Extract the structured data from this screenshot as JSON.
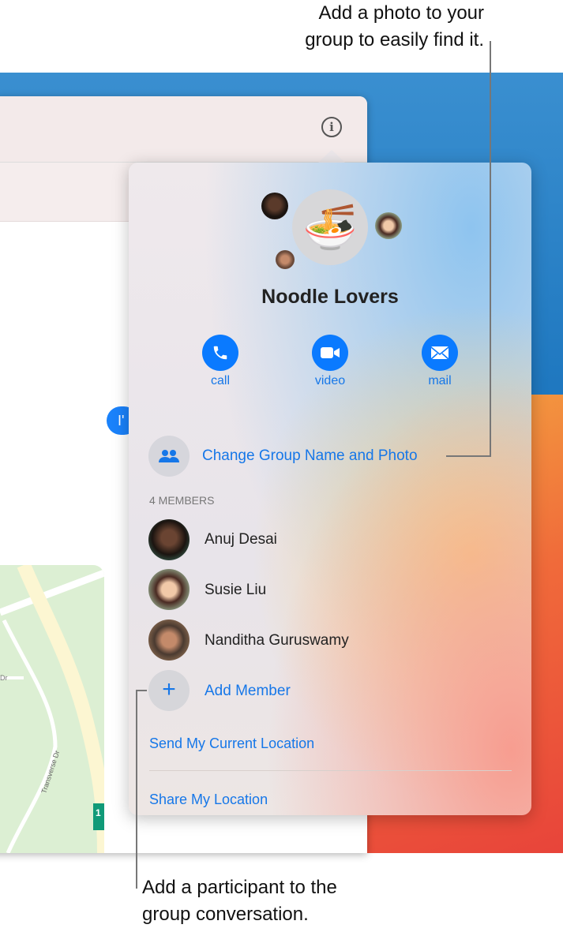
{
  "annotations": {
    "top": [
      "Add a photo to your",
      "group to easily find it."
    ],
    "bottom": [
      "Add a participant to the",
      "group conversation."
    ]
  },
  "window": {
    "info_icon": "info-icon",
    "bubble_text": "I'",
    "map_labels": {
      "road": "Transverse Dr",
      "fragment": "Dr",
      "route": "1"
    }
  },
  "popover": {
    "group_name": "Noodle Lovers",
    "group_photo": "noodle-bowl-emoji",
    "group_emoji": "🍜",
    "actions": [
      {
        "label": "call",
        "icon": "phone-icon"
      },
      {
        "label": "video",
        "icon": "video-camera-icon"
      },
      {
        "label": "mail",
        "icon": "envelope-icon"
      }
    ],
    "change_label": "Change Group Name and Photo",
    "members_header": "4 MEMBERS",
    "members": [
      {
        "name": "Anuj Desai"
      },
      {
        "name": "Susie Liu"
      },
      {
        "name": "Nanditha Guruswamy"
      }
    ],
    "add_member": "Add Member",
    "send_location": "Send My Current Location",
    "share_location": "Share My Location"
  },
  "colors": {
    "accent": "#0a7aff",
    "link": "#1677e8"
  }
}
